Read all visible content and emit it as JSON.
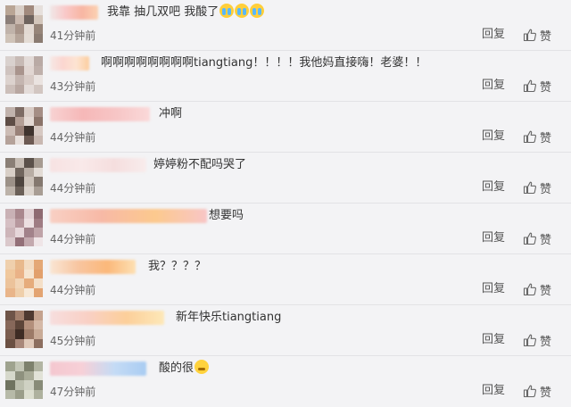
{
  "comments": [
    {
      "text": "我靠 抽几双吧 我酸了",
      "emoji": [
        "crying-face",
        "crying-face",
        "crying-face"
      ],
      "time": "41分钟前",
      "reply": "回复",
      "like": "赞",
      "avatar": [
        "#b9a595",
        "#d9cfc7",
        "#a18a7d",
        "#e6e0dc",
        "#8c7f79",
        "#c9b8ae",
        "#6f645e",
        "#d3c6bb",
        "#c0b3aa",
        "#a79489",
        "#e2d9d2",
        "#968579",
        "#cfc3b8",
        "#b5a59a",
        "#e4dcd5",
        "#8a7b71"
      ],
      "name": [
        "#f0e7e7",
        "#f9c8c8",
        "#f8b6a3",
        "#fcd2b2"
      ]
    },
    {
      "text": "啊啊啊啊啊啊啊啊tiangtiang！！！！我他妈直接嗨！老婆！！",
      "emoji": [],
      "time": "43分钟前",
      "reply": "回复",
      "like": "赞",
      "avatar": [
        "#d9d1ce",
        "#c7bab5",
        "#e3dbd8",
        "#b9aaa5",
        "#cfc3bf",
        "#a9948d",
        "#e1d6d2",
        "#bfb0ab",
        "#dcd2ce",
        "#c4b5b0",
        "#d8cbc6",
        "#eae3e0",
        "#ccbfba",
        "#b8a7a1",
        "#e4dcd9",
        "#d2c6c1"
      ],
      "name": [
        "#f6e9e6",
        "#fbd6d0",
        "#fde4d2",
        "#fccd9e"
      ]
    },
    {
      "text": "冲啊",
      "emoji": [],
      "time": "44分钟前",
      "reply": "回复",
      "like": "赞",
      "avatar": [
        "#c1b3ad",
        "#7d6b64",
        "#d9ccc6",
        "#a58e85",
        "#5e4d46",
        "#b49f96",
        "#e3d8d3",
        "#8a7369",
        "#ccbcb5",
        "#9a8279",
        "#3f332e",
        "#d6c8c2",
        "#b5a29a",
        "#e8dfdb",
        "#6d5a53",
        "#c9b8b1"
      ],
      "name": [
        "#f7d2d2",
        "#f6b8b8",
        "#f7c6c6",
        "#fad9d9"
      ]
    },
    {
      "text": "婷婷粉不配吗哭了",
      "emoji": [],
      "time": "44分钟前",
      "reply": "回复",
      "like": "赞",
      "avatar": [
        "#8a7f76",
        "#c6bcb3",
        "#5b514a",
        "#a69b91",
        "#d8cfc7",
        "#70655d",
        "#b8ada4",
        "#e2dbd5",
        "#9c9188",
        "#4e453f",
        "#cbc1b8",
        "#84786f",
        "#bcb2a9",
        "#6b6058",
        "#dcd4cd",
        "#a89d94"
      ],
      "name": [
        "#f7e2e2",
        "#f9e9e9",
        "#f5dede",
        "#f8ecec"
      ]
    },
    {
      "text": "想要吗",
      "emoji": [],
      "time": "44分钟前",
      "reply": "回复",
      "like": "赞",
      "avatar": [
        "#c9b1b5",
        "#a9878d",
        "#e2d2d5",
        "#8e6b72",
        "#d5bfc3",
        "#b7989e",
        "#ecdfe1",
        "#9f7c83",
        "#cdb5b9",
        "#e6d6d9",
        "#a2828a",
        "#bfa3a8",
        "#dac8cb",
        "#937078",
        "#c3a9ae",
        "#efe5e7"
      ],
      "name": [
        "#f8d0c4",
        "#f7b9a6",
        "#fcc98e",
        "#f8c6c6"
      ]
    },
    {
      "text": "我？？？？",
      "emoji": [],
      "time": "44分钟前",
      "reply": "回复",
      "like": "赞",
      "avatar": [
        "#efd0ad",
        "#e8b98c",
        "#f3dcc2",
        "#e4a876",
        "#f0c89d",
        "#eab287",
        "#f6e4cf",
        "#e2a06c",
        "#ecc39b",
        "#f2d5b6",
        "#e6ac7c",
        "#f4dfc8",
        "#e9b58a",
        "#efcfab",
        "#f7e8d6",
        "#e3a472"
      ],
      "name": [
        "#f9e6d4",
        "#f8c5a0",
        "#fbb87a",
        "#fde0b3"
      ]
    },
    {
      "text": "新年快乐tiangtiang",
      "emoji": [],
      "time": "45分钟前",
      "reply": "回复",
      "like": "赞",
      "avatar": [
        "#6e5448",
        "#a17e6b",
        "#4e3930",
        "#c4a28e",
        "#87685a",
        "#5d4539",
        "#b38f7b",
        "#d5b9a7",
        "#7a5d4f",
        "#3e2c24",
        "#9c7a67",
        "#c9ab97",
        "#6b5043",
        "#a9887a",
        "#e0c9b9",
        "#8c6e5f"
      ],
      "name": [
        "#f7dede",
        "#f9d0c5",
        "#fccf9a",
        "#fde8b8"
      ]
    },
    {
      "text": "酸的很",
      "emoji": [
        "sour-face"
      ],
      "time": "47分钟前",
      "reply": "回复",
      "like": "赞",
      "avatar": [
        "#9fa38f",
        "#c3c6b6",
        "#7d816d",
        "#b2b5a3",
        "#d6d8cb",
        "#8e917e",
        "#a9ac98",
        "#e1e2d7",
        "#6f7360",
        "#bcbfae",
        "#cfd1c3",
        "#888b78",
        "#b7baa8",
        "#9a9d89",
        "#dcdecf",
        "#aeb19e"
      ],
      "name": [
        "#f4c7cf",
        "#f7d0d7",
        "#c4dbf5",
        "#a9ccf2"
      ]
    }
  ],
  "icons": {
    "like": "thumbs-up-icon"
  }
}
